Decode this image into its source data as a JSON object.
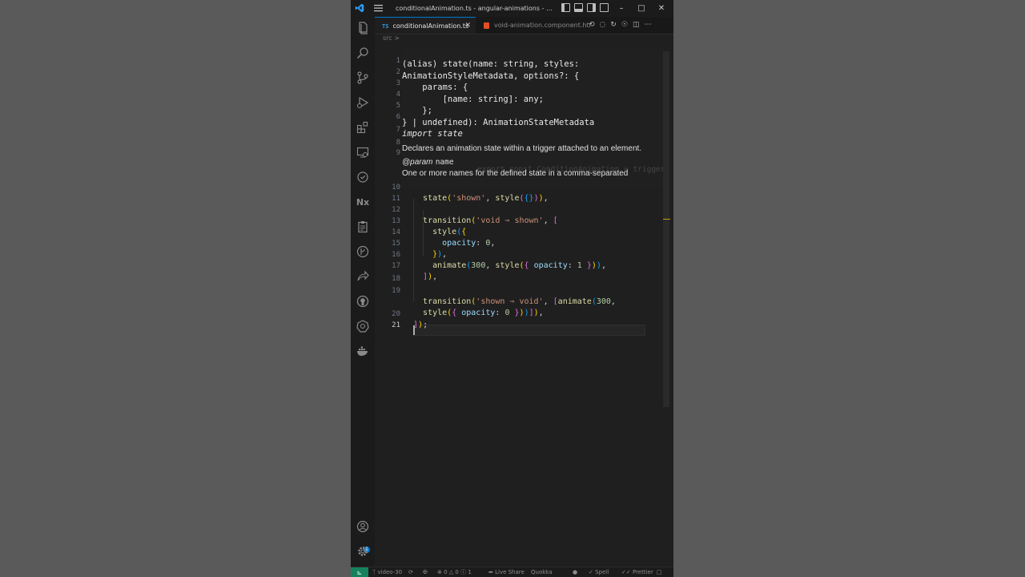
{
  "window": {
    "title": "conditionalAnimation.ts - angular-animations - Visu..."
  },
  "tabs": [
    {
      "label": "conditionalAnimation.ts",
      "badge": "TS",
      "active": true
    },
    {
      "label": "void-animation.component.htr",
      "badge": "html",
      "active": false
    }
  ],
  "breadcrumb": "src >",
  "hover": {
    "signature_lines": [
      "(alias) state(name: string, styles:",
      "AnimationStyleMetadata, options?: {",
      "    params: {",
      "        [name: string]: any;",
      "    };",
      "} | undefined): AnimationStateMetadata",
      "import state"
    ],
    "description": "Declares an animation state within a trigger attached to an element.",
    "param_tag": "@param",
    "param_name": "name",
    "param_desc": "One or more names for the defined state in a comma-separated"
  },
  "code": {
    "lines": [
      {
        "n": "10",
        "text": "  state('shown', style({})),"
      },
      {
        "n": "11",
        "text": ""
      },
      {
        "n": "12",
        "text": "  transition('void => shown', ["
      },
      {
        "n": "13",
        "text": "    style({"
      },
      {
        "n": "14",
        "text": "      opacity: 0,"
      },
      {
        "n": "15",
        "text": "    }),"
      },
      {
        "n": "16",
        "text": "    animate(300, style({ opacity: 1 })),"
      },
      {
        "n": "17",
        "text": "  ]),"
      },
      {
        "n": "18",
        "text": ""
      },
      {
        "n": "19",
        "text": "  transition('shown => void', [animate(300,"
      },
      {
        "n": "",
        "text": "  style({ opacity: 0 }))]),"
      },
      {
        "n": "20",
        "text": "]);"
      },
      {
        "n": "21",
        "text": ""
      }
    ],
    "hidden_line_numbers": [
      "1",
      "2",
      "3",
      "4",
      "5",
      "6",
      "7",
      "8",
      "9"
    ],
    "ghost_text": "export const ConditionAnimation = trigger"
  },
  "statusbar": {
    "branch": "video-30",
    "problems": "0",
    "warnings": "0",
    "info": "1",
    "live_share": "Live Share",
    "quokka": "Quokka",
    "spell": "Spell",
    "prettier": "Prettier"
  },
  "activity_icons": [
    "explorer-icon",
    "search-icon",
    "source-control-icon",
    "run-debug-icon",
    "extensions-icon",
    "remote-explorer-icon",
    "testing-icon",
    "nx-console-icon",
    "clipboard-icon",
    "gitlens-icon",
    "live-share-icon",
    "github-icon",
    "kubernetes-icon",
    "docker-icon",
    "account-icon",
    "manage-gear-icon"
  ],
  "colors": {
    "editor_bg": "#1f1f1f",
    "accent": "#0078d4",
    "string": "#ce9178",
    "function": "#dcdcaa",
    "property": "#9cdcfe",
    "number": "#b5cea8"
  }
}
